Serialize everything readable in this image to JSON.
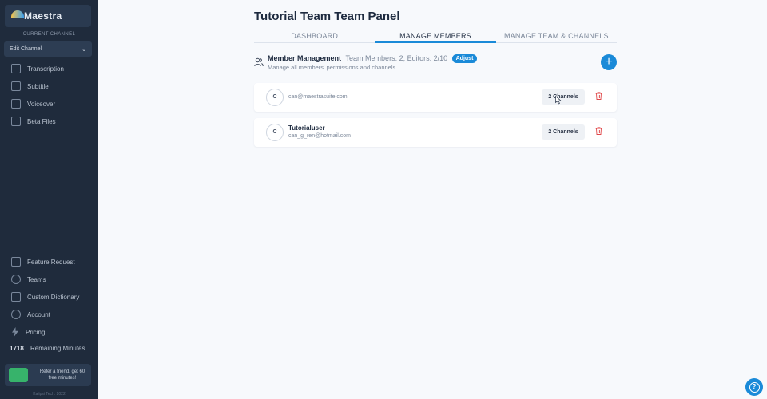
{
  "sidebar": {
    "app_name": "Maestra",
    "current_channel_label": "CURRENT CHANNEL",
    "channel_select": "Edit Channel",
    "items_top": [
      {
        "label": "Transcription",
        "icon": "transcription-icon"
      },
      {
        "label": "Subtitle",
        "icon": "subtitle-icon"
      },
      {
        "label": "Voiceover",
        "icon": "voiceover-icon"
      },
      {
        "label": "Beta Files",
        "icon": "beta-files-icon"
      }
    ],
    "items_bottom": [
      {
        "label": "Feature Request",
        "icon": "thumbs-up-icon"
      },
      {
        "label": "Teams",
        "icon": "teams-icon"
      },
      {
        "label": "Custom Dictionary",
        "icon": "dictionary-icon"
      },
      {
        "label": "Account",
        "icon": "account-icon"
      },
      {
        "label": "Pricing",
        "icon": "bolt-icon"
      }
    ],
    "remaining_minutes": {
      "value": "1718",
      "label": "Remaining Minutes"
    },
    "referral_text": "Refer a friend, get 60 free minutes!",
    "copyright": "Kalipsi Tech. 2022"
  },
  "main": {
    "title": "Tutorial Team Team Panel",
    "tabs": [
      {
        "label": "DASHBOARD",
        "active": false
      },
      {
        "label": "MANAGE MEMBERS",
        "active": true
      },
      {
        "label": "MANAGE TEAM & CHANNELS",
        "active": false
      }
    ],
    "member_management": {
      "title": "Member Management",
      "meta": "Team Members: 2, Editors: 2/10",
      "adjust_label": "Adjust",
      "subtitle": "Manage all members' permissions and channels.",
      "add_label": "+"
    },
    "members": [
      {
        "initial": "C",
        "name": "",
        "email": "can@maestrasuite.com",
        "channels_label": "2 Channels"
      },
      {
        "initial": "C",
        "name": "Tutorialuser",
        "email": "can_g_ren@hotmail.com",
        "channels_label": "2 Channels"
      }
    ]
  },
  "help": {
    "label": "?"
  },
  "colors": {
    "accent": "#1a8ad8",
    "sidebar_bg": "#1f2b3c",
    "danger": "#e0484a"
  }
}
